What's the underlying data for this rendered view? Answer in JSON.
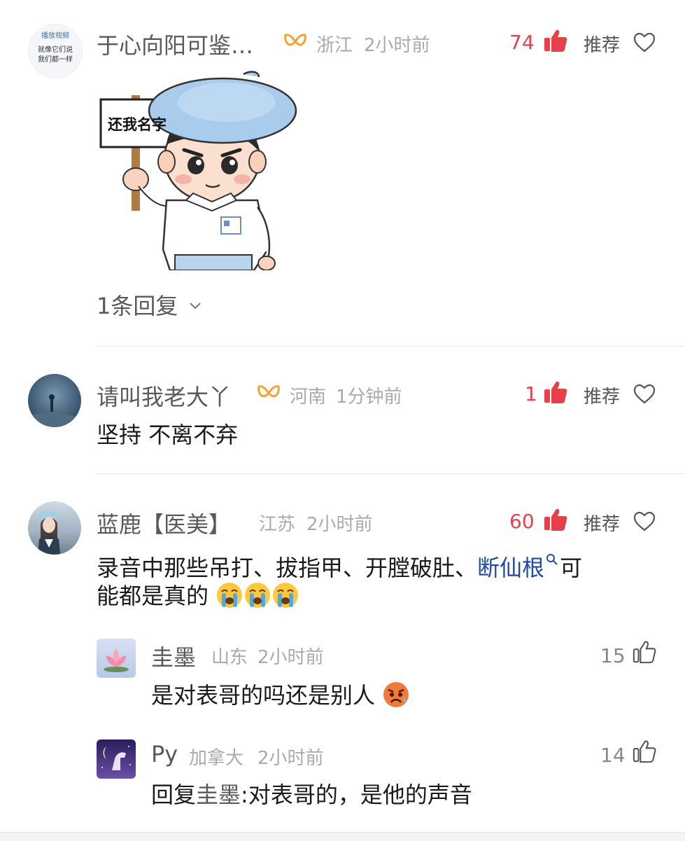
{
  "comments": [
    {
      "author": "于心向阳可鉴…",
      "location": "浙江",
      "time": "2小时前",
      "likes": "74",
      "recommend_label": "推荐",
      "sticker_text": "还我名字",
      "replies_label": "1条回复",
      "avatar_text_1": "播放视频",
      "avatar_text_2": "就像它们说",
      "avatar_text_3": "我们都一样"
    },
    {
      "author": "请叫我老大丫",
      "location": "河南",
      "time": "1分钟前",
      "likes": "1",
      "recommend_label": "推荐",
      "text": "坚持 不离不弃"
    },
    {
      "author": "蓝鹿【医美】",
      "location": "江苏",
      "time": "2小时前",
      "likes": "60",
      "recommend_label": "推荐",
      "text_line1_prefix": "录音中那些吊打、拔指甲、开膛破肚、",
      "text_link": "断仙根",
      "text_line1_suffix": "可",
      "text_line2": "能都是真的",
      "replies": [
        {
          "author": "圭墨",
          "location": "山东",
          "time": "2小时前",
          "likes": "15",
          "text": "是对表哥的吗还是别人"
        },
        {
          "author": "Py",
          "location": "加拿大",
          "time": "2小时前",
          "likes": "14",
          "reply_prefix": "回复",
          "reply_to": "圭墨",
          "text": ":对表哥的，是他的声音"
        }
      ]
    }
  ],
  "colors": {
    "like_red": "#e8404a",
    "link_blue": "#1f4aa8",
    "badge_orange": "#f2a33a"
  }
}
